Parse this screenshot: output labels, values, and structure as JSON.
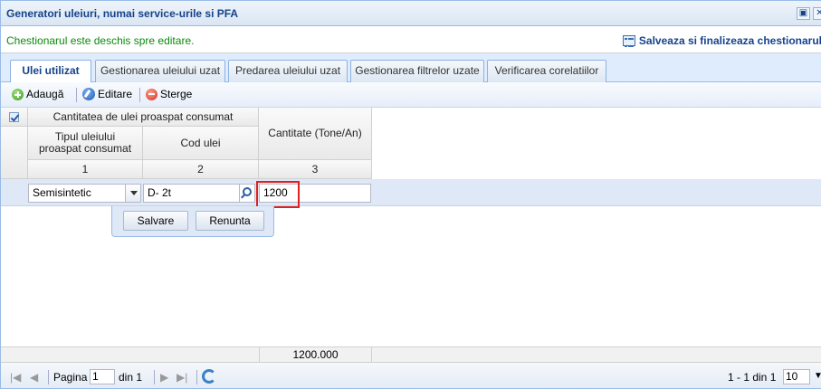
{
  "panel": {
    "title": "Generatori uleiuri, numai service-urile si PFA",
    "restore_glyph": "▣",
    "close_glyph": "✕"
  },
  "status": {
    "message": "Chestionarul este deschis spre editare.",
    "finalize_label": "Salveaza si finalizeaza chestionarul"
  },
  "tabs": [
    {
      "label": "Ulei utilizat",
      "active": true
    },
    {
      "label": "Gestionarea uleiului uzat",
      "active": false
    },
    {
      "label": "Predarea uleiului uzat",
      "active": false
    },
    {
      "label": "Gestionarea filtrelor uzate",
      "active": false
    },
    {
      "label": "Verificarea corelatiilor",
      "active": false
    }
  ],
  "toolbar": {
    "add_label": "Adaugă",
    "edit_label": "Editare",
    "delete_label": "Sterge"
  },
  "grid": {
    "group_header": "Cantitatea de ulei proaspat consumat",
    "col1_header": "Tipul uleiului proaspat consumat",
    "col2_header": "Cod ulei",
    "col3_header": "Cantitate (Tone/An)",
    "col1_num": "1",
    "col2_num": "2",
    "col3_num": "3"
  },
  "editor": {
    "type_value": "Semisintetic",
    "code_value": "D- 2t",
    "quantity_value": "1200",
    "save_label": "Salvare",
    "cancel_label": "Renunta"
  },
  "summary": {
    "total": "1200.000"
  },
  "pager": {
    "page_label": "Pagina",
    "page_value": "1",
    "of_label": "din 1",
    "range_label": "1 - 1 din 1",
    "page_size": "10"
  },
  "icons": {
    "add": "add-icon",
    "edit": "edit-icon",
    "delete": "delete-icon",
    "finalize": "list-icon",
    "search": "search-icon",
    "refresh": "refresh-icon"
  },
  "colors": {
    "accent": "#15428b",
    "status_ok": "#0a8a0a",
    "highlight": "#e02020"
  }
}
